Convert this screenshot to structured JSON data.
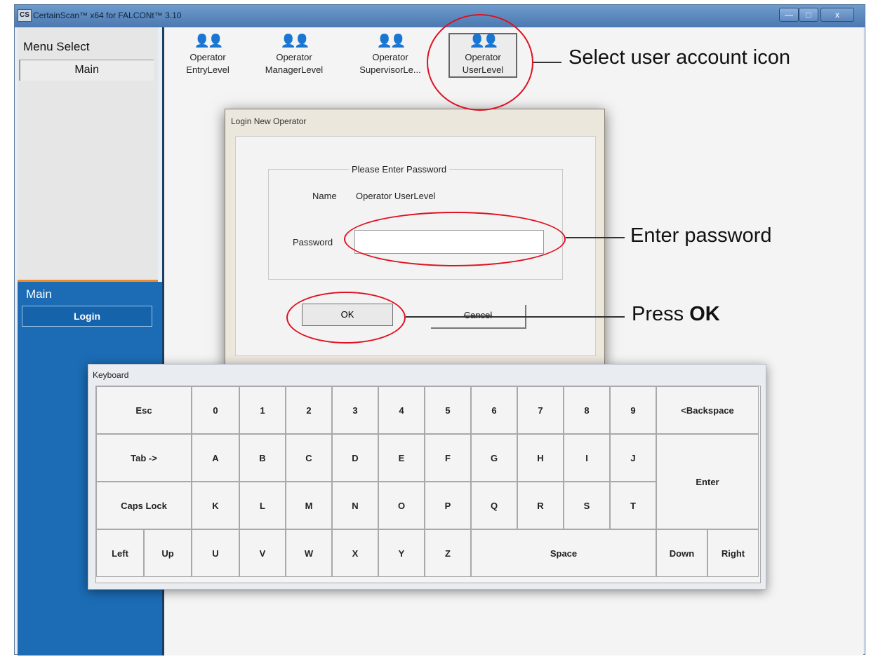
{
  "window": {
    "app_icon": "CS",
    "title": "CertainScan™ x64 for FALCONt™ 3.10",
    "controls": {
      "minimize": "—",
      "maximize": "□",
      "close": "x"
    }
  },
  "menu": {
    "title": "Menu Select",
    "selected": "Main"
  },
  "sidebar": {
    "section_label": "Main",
    "login_button": "Login"
  },
  "operators": [
    {
      "line1": "Operator",
      "line2": "EntryLevel"
    },
    {
      "line1": "Operator",
      "line2": "ManagerLevel"
    },
    {
      "line1": "Operator",
      "line2": "SupervisorLe..."
    },
    {
      "line1": "Operator",
      "line2": "UserLevel"
    }
  ],
  "operator_icon": "users-icon",
  "dialog": {
    "title": "Login New Operator",
    "group_label": "Please Enter Password",
    "name_label": "Name",
    "name_value": "Operator UserLevel",
    "password_label": "Password",
    "password_value": "",
    "ok_label": "OK",
    "cancel_label": "Cancel"
  },
  "keyboard": {
    "title": "Keyboard",
    "keys": [
      "Esc",
      "0",
      "1",
      "2",
      "3",
      "4",
      "5",
      "6",
      "7",
      "8",
      "9",
      "<Backspace",
      "Tab ->",
      "A",
      "B",
      "C",
      "D",
      "E",
      "F",
      "G",
      "H",
      "I",
      "J",
      "Enter",
      "Caps Lock",
      "K",
      "L",
      "M",
      "N",
      "O",
      "P",
      "Q",
      "R",
      "S",
      "T",
      "Left",
      "Up",
      "U",
      "V",
      "W",
      "X",
      "Y",
      "Z",
      "Space",
      "Down",
      "Right"
    ]
  },
  "annotations": {
    "select_icon": "Select user account icon",
    "enter_password": "Enter password",
    "press_prefix": "Press ",
    "press_bold": "OK"
  },
  "colors": {
    "annotation_circle": "#e01020",
    "sidebar_blue": "#1b6cb4",
    "accent_orange": "#f08a2c"
  }
}
